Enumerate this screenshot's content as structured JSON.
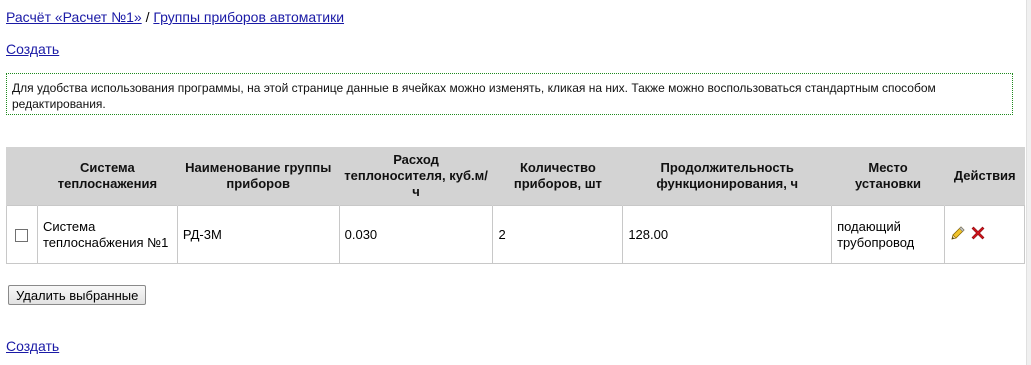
{
  "breadcrumb": {
    "calc_link": "Расчёт «Расчет №1»",
    "separator": " / ",
    "groups_link": "Группы приборов автоматики"
  },
  "create_top": "Создать",
  "notice": "Для удобства использования программы, на этой странице данные в ячейках можно изменять, кликая на них. Также можно воспользоваться стандартным способом редактирования.",
  "table": {
    "headers": {
      "system": "Система теплоснажения",
      "name": "Наименование группы приборов",
      "flow": "Расход теплоносителя, куб.м/ч",
      "count": "Количество приборов, шт",
      "duration": "Продолжительность функционирования, ч",
      "place": "Место установки",
      "actions": "Действия"
    },
    "rows": [
      {
        "system": "Система теплоснабжения №1",
        "name": "РД-3М",
        "flow": "0.030",
        "count": "2",
        "duration": "128.00",
        "place": "подающий трубопровод"
      }
    ]
  },
  "icons": {
    "edit": "pencil-icon",
    "delete": "delete-x-icon"
  },
  "delete_selected_label": "Удалить выбранные",
  "create_bottom": "Создать",
  "colors": {
    "link": "#1a1aa6",
    "header_bg": "#d3d3d3",
    "notice_border": "#1d8a1d",
    "delete_icon": "#d0141b"
  }
}
